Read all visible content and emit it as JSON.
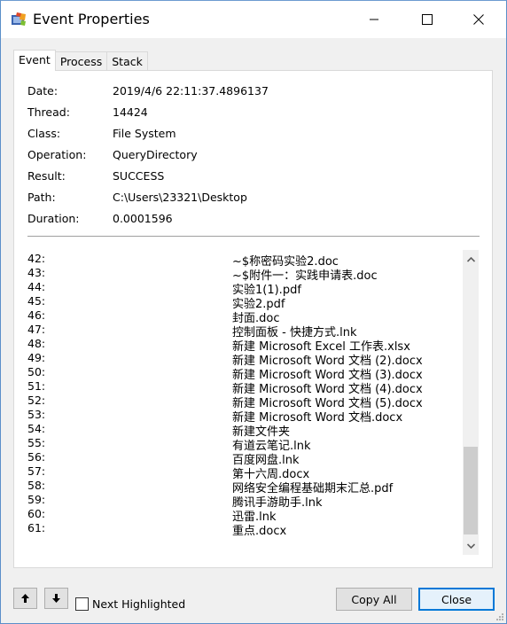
{
  "window": {
    "title": "Event Properties",
    "icon": "process-monitor-app-icon",
    "controls": {
      "minimize": "minimize-icon",
      "maximize": "maximize-icon",
      "close": "close-icon"
    }
  },
  "tabs": [
    {
      "label": "Event",
      "active": true
    },
    {
      "label": "Process",
      "active": false
    },
    {
      "label": "Stack",
      "active": false
    }
  ],
  "properties": [
    {
      "label": "Date:",
      "value": "2019/4/6 22:11:37.4896137"
    },
    {
      "label": "Thread:",
      "value": "14424"
    },
    {
      "label": "Class:",
      "value": "File System"
    },
    {
      "label": "Operation:",
      "value": "QueryDirectory"
    },
    {
      "label": "Result:",
      "value": "SUCCESS"
    },
    {
      "label": "Path:",
      "value": "C:\\Users\\23321\\Desktop"
    },
    {
      "label": "Duration:",
      "value": "0.0001596"
    }
  ],
  "results": [
    {
      "index": "42:",
      "name": "~$称密码实验2.doc"
    },
    {
      "index": "43:",
      "name": "~$附件一：实践申请表.doc"
    },
    {
      "index": "44:",
      "name": "实验1(1).pdf"
    },
    {
      "index": "45:",
      "name": "实验2.pdf"
    },
    {
      "index": "46:",
      "name": "封面.doc"
    },
    {
      "index": "47:",
      "name": "控制面板 - 快捷方式.lnk"
    },
    {
      "index": "48:",
      "name": "新建 Microsoft Excel 工作表.xlsx"
    },
    {
      "index": "49:",
      "name": "新建 Microsoft Word 文档 (2).docx"
    },
    {
      "index": "50:",
      "name": "新建 Microsoft Word 文档 (3).docx"
    },
    {
      "index": "51:",
      "name": "新建 Microsoft Word 文档 (4).docx"
    },
    {
      "index": "52:",
      "name": "新建 Microsoft Word 文档 (5).docx"
    },
    {
      "index": "53:",
      "name": "新建 Microsoft Word 文档.docx"
    },
    {
      "index": "54:",
      "name": "新建文件夹"
    },
    {
      "index": "55:",
      "name": "有道云笔记.lnk"
    },
    {
      "index": "56:",
      "name": "百度网盘.lnk"
    },
    {
      "index": "57:",
      "name": "第十六周.docx"
    },
    {
      "index": "58:",
      "name": "网络安全编程基础期末汇总.pdf"
    },
    {
      "index": "59:",
      "name": "腾讯手游助手.lnk"
    },
    {
      "index": "60:",
      "name": "迅雷.lnk"
    },
    {
      "index": "61:",
      "name": "重点.docx"
    }
  ],
  "footer": {
    "up_button": "arrow-up-icon",
    "down_button": "arrow-down-icon",
    "next_highlighted_label": "Next Highlighted",
    "next_highlighted_checked": false,
    "copy_all_label": "Copy All",
    "close_label": "Close"
  },
  "colors": {
    "accent": "#0078d7",
    "window_border": "#5a8fc9",
    "dialog_bg": "#f0f0f0",
    "scroll_thumb": "#cdcdcd"
  }
}
